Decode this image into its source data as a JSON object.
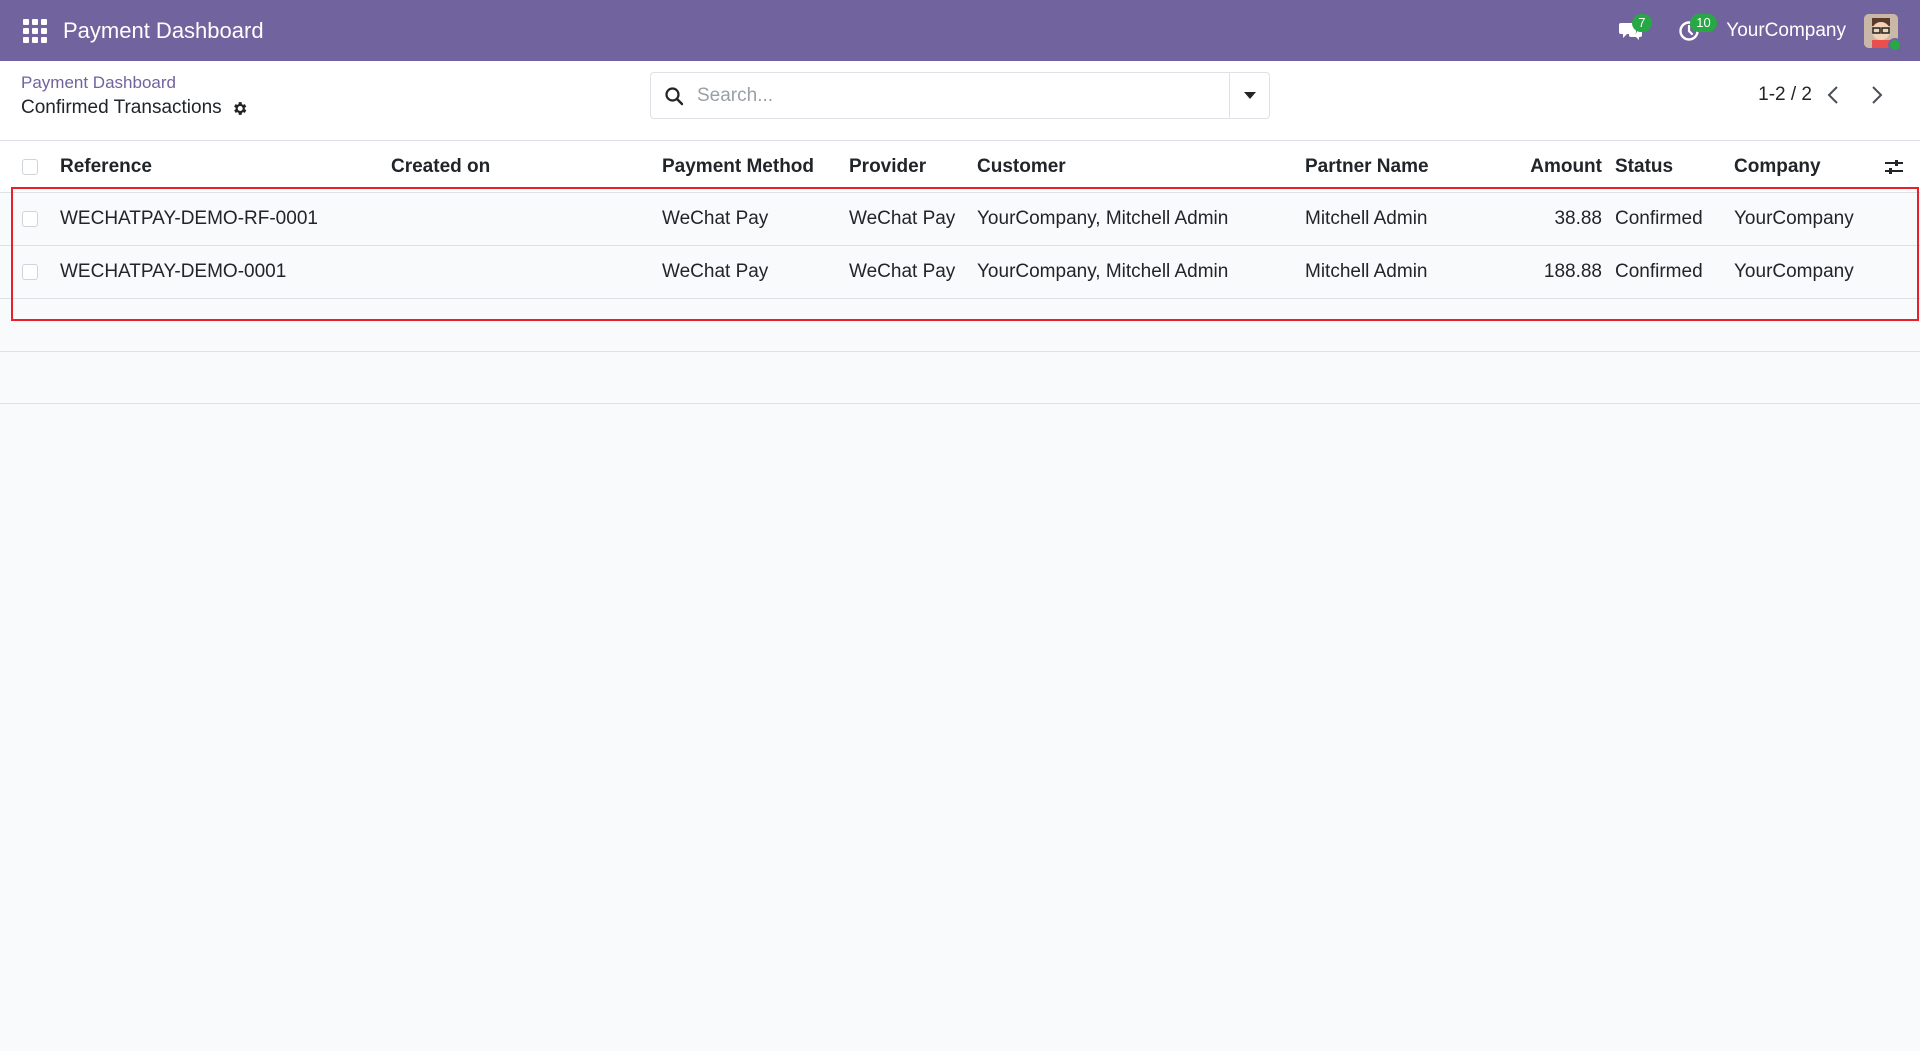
{
  "navbar": {
    "app_title": "Payment Dashboard",
    "apps_icon": "grid-apps-icon",
    "messages_icon": "chat-bubbles-icon",
    "messages_count": "7",
    "activities_icon": "clock-icon",
    "activities_count": "10",
    "company": "YourCompany",
    "avatar_icon": "user-avatar-icon",
    "color": "#71639e"
  },
  "control_panel": {
    "breadcrumb_parent": "Payment Dashboard",
    "breadcrumb_current": "Confirmed Transactions",
    "settings_icon": "gear-icon",
    "search": {
      "placeholder": "Search...",
      "value": ""
    },
    "pager": {
      "value": "1-2 / 2"
    }
  },
  "list": {
    "columns": {
      "reference": "Reference",
      "created_on": "Created on",
      "payment_method": "Payment Method",
      "provider": "Provider",
      "customer": "Customer",
      "partner_name": "Partner Name",
      "amount": "Amount",
      "status": "Status",
      "company": "Company"
    },
    "optional_columns_icon": "sliders-icon",
    "rows": [
      {
        "reference": "WECHATPAY-DEMO-RF-0001",
        "created_on": "",
        "payment_method": "WeChat Pay",
        "provider": "WeChat Pay",
        "customer": "YourCompany, Mitchell Admin",
        "partner_name": "Mitchell Admin",
        "amount": "38.88",
        "status": "Confirmed",
        "company": "YourCompany"
      },
      {
        "reference": "WECHATPAY-DEMO-0001",
        "created_on": "",
        "payment_method": "WeChat Pay",
        "provider": "WeChat Pay",
        "customer": "YourCompany, Mitchell Admin",
        "partner_name": "Mitchell Admin",
        "amount": "188.88",
        "status": "Confirmed",
        "company": "YourCompany"
      }
    ]
  },
  "colors": {
    "accent": "#71639e",
    "highlight": "#e8202a",
    "badge": "#28a745"
  }
}
